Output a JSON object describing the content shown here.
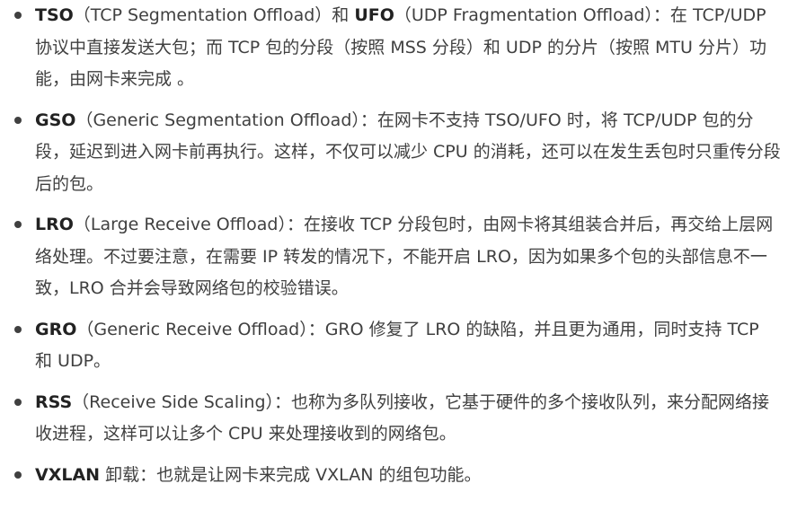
{
  "items": [
    {
      "term": "TSO",
      "text": "（TCP Segmentation Offload）和 ",
      "term2": "UFO",
      "text2": "（UDP Fragmentation Offload）：在 TCP/UDP 协议中直接发送大包；而 TCP 包的分段（按照 MSS 分段）和 UDP 的分片（按照 MTU 分片）功能，由网卡来完成 。"
    },
    {
      "term": "GSO",
      "text": "（Generic Segmentation Offload）：在网卡不支持 TSO/UFO 时，将 TCP/UDP 包的分段，延迟到进入网卡前再执行。这样，不仅可以减少 CPU 的消耗，还可以在发生丢包时只重传分段后的包。"
    },
    {
      "term": "LRO",
      "text": "（Large Receive Offload）：在接收 TCP 分段包时，由网卡将其组装合并后，再交给上层网络处理。不过要注意，在需要 IP 转发的情况下，不能开启 LRO，因为如果多个包的头部信息不一致，LRO 合并会导致网络包的校验错误。"
    },
    {
      "term": "GRO",
      "text": "（Generic Receive Offload）：GRO 修复了 LRO 的缺陷，并且更为通用，同时支持 TCP 和 UDP。"
    },
    {
      "term": "RSS",
      "text": "（Receive Side Scaling）：也称为多队列接收，它基于硬件的多个接收队列，来分配网络接收进程，这样可以让多个 CPU 来处理接收到的网络包。"
    },
    {
      "term": "VXLAN",
      "text": " 卸载：也就是让网卡来完成 VXLAN 的组包功能。"
    }
  ]
}
